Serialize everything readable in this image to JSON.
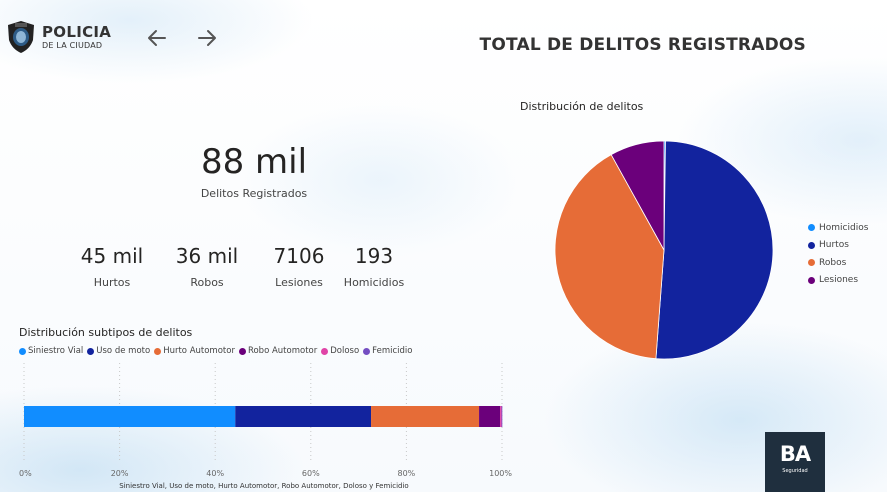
{
  "header": {
    "logo_line1": "POLICIA",
    "logo_line2": "DE LA CIUDAD",
    "badge_text": "POLICIA",
    "back_icon": "arrow-left-icon",
    "forward_icon": "arrow-right-icon",
    "title": "TOTAL DE DELITOS REGISTRADOS"
  },
  "kpis": {
    "main": {
      "value": "88 mil",
      "label": "Delitos Registrados"
    },
    "items": [
      {
        "value": "45 mil",
        "label": "Hurtos"
      },
      {
        "value": "36 mil",
        "label": "Robos"
      },
      {
        "value": "7106",
        "label": "Lesiones"
      },
      {
        "value": "193",
        "label": "Homicidios"
      }
    ]
  },
  "colors": {
    "homicidios": "#118DFF",
    "hurtos": "#12239E",
    "robos": "#E66C37",
    "lesiones": "#6B007B",
    "doloso": "#E044A7",
    "femicidio": "#744EC2"
  },
  "chart_data": [
    {
      "type": "pie",
      "title": "Distribución de delitos",
      "legend_position": "right",
      "series": [
        {
          "name": "Homicidios",
          "value": 193,
          "color": "#118DFF"
        },
        {
          "name": "Hurtos",
          "value": 45000,
          "color": "#12239E"
        },
        {
          "name": "Robos",
          "value": 36000,
          "color": "#E66C37"
        },
        {
          "name": "Lesiones",
          "value": 7106,
          "color": "#6B007B"
        }
      ],
      "draw_order": [
        "Homicidios",
        "Hurtos",
        "Robos",
        "Lesiones"
      ]
    },
    {
      "type": "bar",
      "orientation": "horizontal",
      "stacked": "100%",
      "title": "Distribución subtipos de delitos",
      "xlabel": "Siniestro Vial, Uso de moto, Hurto Automotor, Robo Automotor, Doloso y Femicidio",
      "xticks": [
        "0%",
        "20%",
        "40%",
        "60%",
        "80%",
        "100%"
      ],
      "xlim": [
        0,
        100
      ],
      "grid": true,
      "legend_position": "top-left",
      "series": [
        {
          "name": "Siniestro Vial",
          "value": 44.2,
          "color": "#118DFF"
        },
        {
          "name": "Uso de moto",
          "value": 28.4,
          "color": "#12239E"
        },
        {
          "name": "Hurto Automotor",
          "value": 22.6,
          "color": "#E66C37"
        },
        {
          "name": "Robo Automotor",
          "value": 4.4,
          "color": "#6B007B"
        },
        {
          "name": "Doloso",
          "value": 0.3,
          "color": "#E044A7"
        },
        {
          "name": "Femicidio",
          "value": 0.1,
          "color": "#744EC2"
        }
      ]
    }
  ],
  "ba_logo": {
    "text": "BA",
    "subtext": "Seguridad"
  }
}
